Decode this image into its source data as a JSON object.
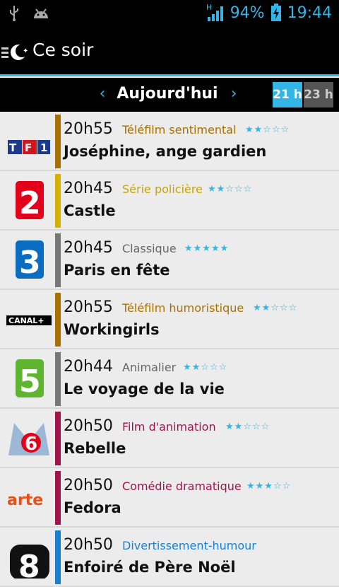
{
  "statusbar": {
    "battery": "94%",
    "clock": "19:44",
    "network": "H"
  },
  "actionbar": {
    "title": "Ce soir"
  },
  "daybar": {
    "prev": "‹",
    "day": "Aujourd'hui",
    "next": "›",
    "hour_selected": "21 h",
    "hour_other": "23 h"
  },
  "programs": [
    {
      "channel": "TF1",
      "time": "20h55",
      "genre": "Téléfilm sentimental",
      "genre_color": "#a87000",
      "stripe_color": "#a87000",
      "rating": 2,
      "title": "Joséphine, ange gardien"
    },
    {
      "channel": "France 2",
      "time": "20h45",
      "genre": "Série policière",
      "genre_color": "#c9a300",
      "stripe_color": "#d6b000",
      "rating": 2,
      "title": "Castle"
    },
    {
      "channel": "France 3",
      "time": "20h45",
      "genre": "Classique",
      "genre_color": "#666666",
      "stripe_color": "#777777",
      "rating": 5,
      "title": "Paris en fête"
    },
    {
      "channel": "CANAL+",
      "time": "20h55",
      "genre": "Téléfilm humoristique",
      "genre_color": "#a87000",
      "stripe_color": "#a87000",
      "rating": 2,
      "title": "Workingirls"
    },
    {
      "channel": "France 5",
      "time": "20h44",
      "genre": "Animalier",
      "genre_color": "#666666",
      "stripe_color": "#777777",
      "rating": 2,
      "title": "Le voyage de la vie"
    },
    {
      "channel": "M6",
      "time": "20h50",
      "genre": "Film d'animation",
      "genre_color": "#a0144a",
      "stripe_color": "#a0144a",
      "rating": 2,
      "title": "Rebelle"
    },
    {
      "channel": "arte",
      "time": "20h50",
      "genre": "Comédie dramatique",
      "genre_color": "#a0144a",
      "stripe_color": "#a0144a",
      "rating": 3,
      "title": "Fedora"
    },
    {
      "channel": "D8",
      "time": "20h50",
      "genre": "Divertissement-humour",
      "genre_color": "#1a7fd0",
      "stripe_color": "#1a7fd0",
      "rating": 0,
      "title": "Enfoiré de Père Noël"
    }
  ]
}
